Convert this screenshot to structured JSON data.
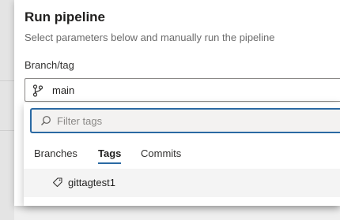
{
  "dialog": {
    "title": "Run pipeline",
    "subtitle": "Select parameters below and manually run the pipeline"
  },
  "branch_field": {
    "label": "Branch/tag",
    "value": "main",
    "icon": "branch-icon"
  },
  "dropdown": {
    "filter": {
      "placeholder": "Filter tags",
      "value": "",
      "icon": "search-icon"
    },
    "tabs": [
      {
        "label": "Branches",
        "selected": false
      },
      {
        "label": "Tags",
        "selected": true
      },
      {
        "label": "Commits",
        "selected": false
      }
    ],
    "items": [
      {
        "label": "gittagtest1",
        "icon": "tag-icon"
      }
    ]
  },
  "colors": {
    "accent": "#2b6aa3",
    "row_highlight": "#f4f4f4",
    "text_secondary": "#6b6b6b"
  }
}
